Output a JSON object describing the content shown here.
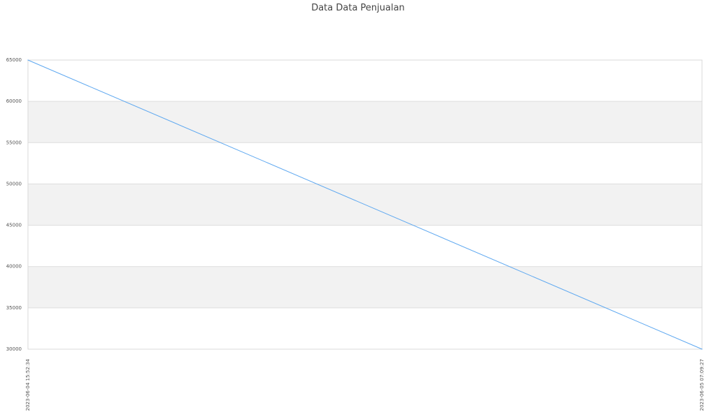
{
  "chart_data": {
    "type": "line",
    "title": "Data Data Penjualan",
    "xlabel": "",
    "ylabel": "",
    "x": [
      "2023-06-04 15:52:34",
      "2023-06-05 07:09:27"
    ],
    "series": [
      {
        "values": [
          65000,
          30000
        ],
        "color": "#5ea8f0"
      }
    ],
    "ylim": [
      30000,
      65000
    ],
    "yticks": [
      30000,
      35000,
      40000,
      45000,
      50000,
      55000,
      60000,
      65000
    ],
    "grid": true,
    "band_color": "#f2f2f2",
    "grid_color": "#dddddd",
    "legend": "none"
  }
}
